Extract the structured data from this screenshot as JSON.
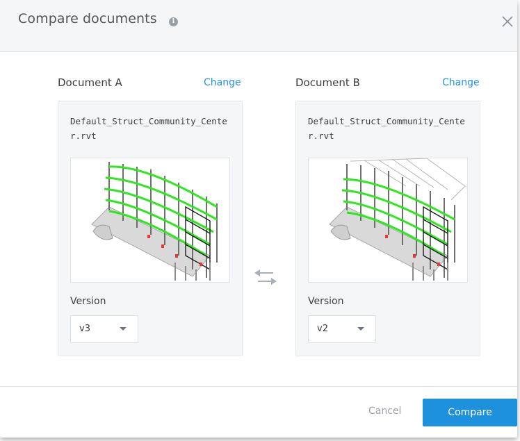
{
  "dialog": {
    "title": "Compare documents",
    "info_icon": "info-icon",
    "close_icon": "close-icon"
  },
  "document_a": {
    "heading": "Document A",
    "change_label": "Change",
    "file_name": "Default_Struct_Community_Center.rvt",
    "version_label": "Version",
    "version_value": "v3"
  },
  "document_b": {
    "heading": "Document B",
    "change_label": "Change",
    "file_name": "Default_Struct_Community_Center.rvt",
    "version_label": "Version",
    "version_value": "v2"
  },
  "swap_icon": "swap-arrows-icon",
  "footer": {
    "cancel_label": "Cancel",
    "compare_label": "Compare"
  },
  "colors": {
    "accent": "#1d91dc",
    "link": "#1f96e0",
    "model_highlight": "#2ee81f"
  }
}
